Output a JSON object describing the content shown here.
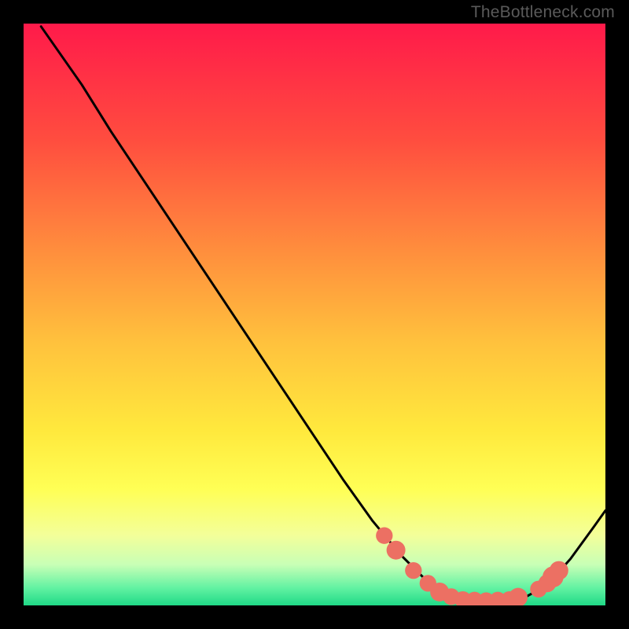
{
  "watermark": "TheBottleneck.com",
  "chart_data": {
    "type": "line",
    "title": "",
    "xlabel": "",
    "ylabel": "",
    "xlim": [
      0,
      100
    ],
    "ylim": [
      0,
      100
    ],
    "grid": false,
    "legend": false,
    "gradient_stops": [
      {
        "offset": 0,
        "color": "#ff1a4a"
      },
      {
        "offset": 20,
        "color": "#ff4d3f"
      },
      {
        "offset": 40,
        "color": "#ff913d"
      },
      {
        "offset": 55,
        "color": "#ffc23d"
      },
      {
        "offset": 70,
        "color": "#ffe93d"
      },
      {
        "offset": 80,
        "color": "#ffff55"
      },
      {
        "offset": 88,
        "color": "#f3ff9a"
      },
      {
        "offset": 93,
        "color": "#c8ffb6"
      },
      {
        "offset": 97,
        "color": "#62f2a2"
      },
      {
        "offset": 100,
        "color": "#1fd987"
      }
    ],
    "curve_note": "Black bottleneck curve; deep minimum near x≈80.",
    "curve_points": [
      {
        "x": 3.0,
        "y": 99.5
      },
      {
        "x": 10.0,
        "y": 89.5
      },
      {
        "x": 15.0,
        "y": 81.5
      },
      {
        "x": 20.0,
        "y": 74.0
      },
      {
        "x": 25.0,
        "y": 66.5
      },
      {
        "x": 30.0,
        "y": 59.0
      },
      {
        "x": 35.0,
        "y": 51.5
      },
      {
        "x": 40.0,
        "y": 44.0
      },
      {
        "x": 45.0,
        "y": 36.5
      },
      {
        "x": 50.0,
        "y": 29.0
      },
      {
        "x": 55.0,
        "y": 21.5
      },
      {
        "x": 60.0,
        "y": 14.5
      },
      {
        "x": 65.0,
        "y": 8.5
      },
      {
        "x": 70.0,
        "y": 3.5
      },
      {
        "x": 74.0,
        "y": 1.3
      },
      {
        "x": 78.0,
        "y": 0.8
      },
      {
        "x": 82.0,
        "y": 0.8
      },
      {
        "x": 86.0,
        "y": 1.3
      },
      {
        "x": 90.0,
        "y": 3.5
      },
      {
        "x": 94.0,
        "y": 8.0
      },
      {
        "x": 98.0,
        "y": 13.5
      },
      {
        "x": 100.0,
        "y": 16.3
      }
    ],
    "markers_note": "Salmon dots near the minimum on both flanks.",
    "markers": [
      {
        "x": 62.0,
        "y": 12.0,
        "r": 1.0
      },
      {
        "x": 64.0,
        "y": 9.5,
        "r": 1.2
      },
      {
        "x": 67.0,
        "y": 6.0,
        "r": 1.0
      },
      {
        "x": 69.5,
        "y": 3.8,
        "r": 1.0
      },
      {
        "x": 71.5,
        "y": 2.3,
        "r": 1.2
      },
      {
        "x": 73.5,
        "y": 1.5,
        "r": 1.0
      },
      {
        "x": 75.5,
        "y": 1.0,
        "r": 1.0
      },
      {
        "x": 77.5,
        "y": 0.9,
        "r": 1.0
      },
      {
        "x": 79.5,
        "y": 0.8,
        "r": 1.0
      },
      {
        "x": 81.5,
        "y": 0.9,
        "r": 1.0
      },
      {
        "x": 83.5,
        "y": 1.0,
        "r": 1.0
      },
      {
        "x": 85.0,
        "y": 1.4,
        "r": 1.2
      },
      {
        "x": 88.5,
        "y": 2.8,
        "r": 1.0
      },
      {
        "x": 90.0,
        "y": 3.8,
        "r": 1.1
      },
      {
        "x": 91.0,
        "y": 4.9,
        "r": 1.4
      },
      {
        "x": 92.0,
        "y": 6.0,
        "r": 1.2
      }
    ],
    "marker_color": "#ec7063",
    "curve_color": "#000000"
  }
}
